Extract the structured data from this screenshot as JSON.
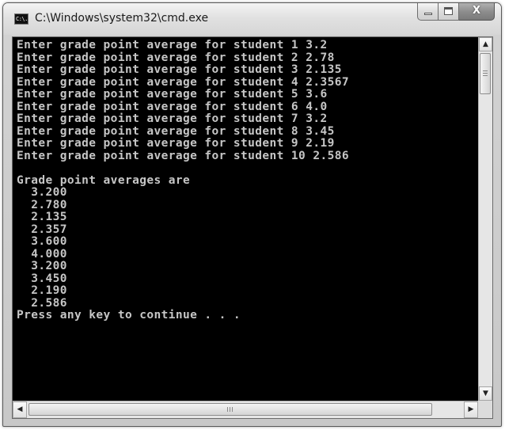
{
  "window": {
    "title": "C:\\Windows\\system32\\cmd.exe",
    "icon_text": "C:\\.",
    "icon": "console-app-icon"
  },
  "caption_buttons": {
    "minimize": "minimize-icon",
    "maximize": "maximize-icon",
    "close_glyph": "X"
  },
  "console": {
    "lines": [
      "Enter grade point average for student 1 3.2",
      "Enter grade point average for student 2 2.78",
      "Enter grade point average for student 3 2.135",
      "Enter grade point average for student 4 2.3567",
      "Enter grade point average for student 5 3.6",
      "Enter grade point average for student 6 4.0",
      "Enter grade point average for student 7 3.2",
      "Enter grade point average for student 8 3.45",
      "Enter grade point average for student 9 2.19",
      "Enter grade point average for student 10 2.586",
      "",
      "Grade point averages are",
      "  3.200",
      "  2.780",
      "  2.135",
      "  2.357",
      "  3.600",
      "  4.000",
      "  3.200",
      "  3.450",
      "  2.190",
      "  2.586",
      "Press any key to continue . . ."
    ],
    "colors": {
      "background": "#000000",
      "text": "#c6c6c6"
    }
  },
  "scrollbars": {
    "up_arrow": "▲",
    "down_arrow": "▼",
    "left_arrow": "◀",
    "right_arrow": "▶"
  }
}
